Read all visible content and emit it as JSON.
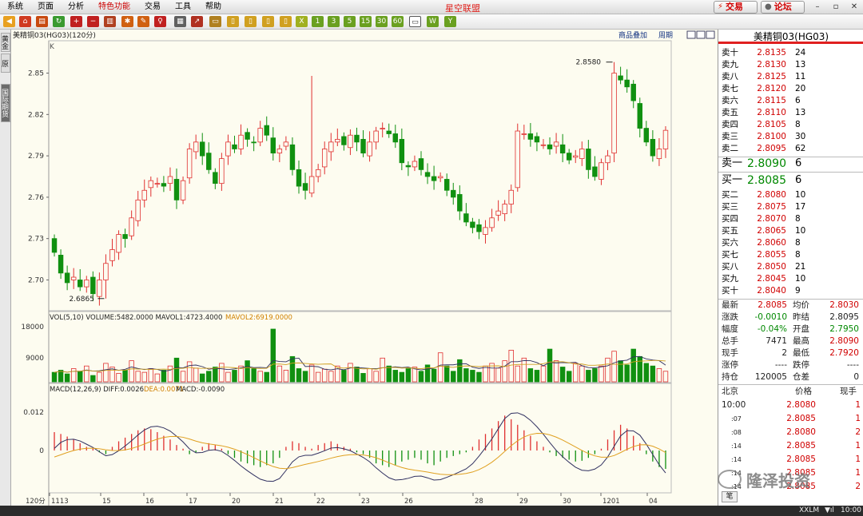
{
  "app": {
    "title": "星空联盟",
    "menu": [
      "系统",
      "页面",
      "分析",
      "特色功能",
      "交易",
      "工具",
      "帮助"
    ],
    "trade_button": "交易",
    "forum_button": "论坛"
  },
  "left_tabs": [
    "黄金",
    "原",
    "国际期货"
  ],
  "chart": {
    "header_left": "美精铜03(HG03)(120分)",
    "header_link1": "商品叠加",
    "header_link2": "周期",
    "k_label": "K",
    "high_label": "2.8580",
    "low_label": "2.6865",
    "period_label": "120分",
    "vol_header": "VOL(5,10) VOLUME:5482.0000 MAVOL1:4723.4000",
    "vol_header_b": "MAVOL2:6919.0000",
    "macd_header": "MACD(12,26,9) DIFF:0.0026",
    "macd_dea": "DEA:0.0071",
    "macd_val": "MACD:-0.0090",
    "colors": {
      "up": "#e03030",
      "down": "#109010",
      "bg": "#fdfcf0",
      "diff": "#303060",
      "dea": "#e0a020"
    }
  },
  "chart_data": {
    "type": "candlestick",
    "price_axis": [
      "2.85",
      "2.82",
      "2.79",
      "2.76",
      "2.73",
      "2.70"
    ],
    "price_range": [
      2.68,
      2.87
    ],
    "vol_axis": [
      "18000",
      "9000"
    ],
    "macd_axis": [
      "0.012",
      "0"
    ],
    "x_labels": [
      "1113",
      "15",
      "16",
      "17",
      "20",
      "21",
      "22",
      "23",
      "26",
      "28",
      "29",
      "30",
      "1201",
      "04"
    ],
    "closes": [
      2.72,
      2.705,
      2.698,
      2.702,
      2.695,
      2.7,
      2.69,
      2.7,
      2.712,
      2.722,
      2.733,
      2.73,
      2.745,
      2.758,
      2.765,
      2.772,
      2.77,
      2.768,
      2.775,
      2.758,
      2.772,
      2.795,
      2.8,
      2.79,
      2.78,
      2.77,
      2.788,
      2.8,
      2.795,
      2.805,
      2.802,
      2.8,
      2.81,
      2.805,
      2.792,
      2.795,
      2.8,
      2.78,
      2.768,
      2.765,
      2.775,
      2.78,
      2.795,
      2.8,
      2.802,
      2.798,
      2.805,
      2.8,
      2.792,
      2.8,
      2.808,
      2.81,
      2.806,
      2.8,
      2.785,
      2.782,
      2.786,
      2.78,
      2.775,
      2.772,
      2.775,
      2.765,
      2.76,
      2.75,
      2.742,
      2.738,
      2.735,
      2.738,
      2.745,
      2.75,
      2.755,
      2.765,
      2.808,
      2.806,
      2.802,
      2.8,
      2.798,
      2.795,
      2.8,
      2.792,
      2.787,
      2.79,
      2.795,
      2.78,
      2.775,
      2.785,
      2.79,
      2.85,
      2.845,
      2.84,
      2.83,
      2.81,
      2.8,
      2.79,
      2.795,
      2.8085
    ],
    "volume_heights": [
      0.18,
      0.22,
      0.15,
      0.25,
      0.2,
      0.3,
      0.12,
      0.18,
      0.35,
      0.28,
      0.16,
      0.22,
      0.4,
      0.2,
      0.18,
      0.25,
      0.15,
      0.22,
      0.3,
      0.45,
      0.2,
      0.38,
      0.26,
      0.15,
      0.2,
      0.28,
      0.35,
      0.18,
      0.22,
      0.3,
      0.4,
      0.25,
      0.2,
      0.18,
      1.0,
      0.3,
      0.22,
      0.48,
      0.25,
      0.2,
      0.32,
      0.18,
      0.24,
      0.2,
      0.3,
      0.22,
      0.35,
      0.28,
      0.16,
      0.25,
      0.2,
      0.45,
      0.3,
      0.22,
      0.18,
      0.25,
      0.28,
      0.2,
      0.32,
      0.24,
      0.55,
      0.3,
      0.2,
      0.42,
      0.25,
      0.22,
      0.18,
      0.3,
      0.35,
      0.26,
      0.4,
      0.6,
      0.3,
      0.45,
      0.25,
      0.22,
      0.3,
      0.62,
      0.4,
      0.28,
      0.2,
      0.35,
      0.3,
      0.22,
      0.25,
      0.3,
      0.45,
      0.58,
      0.4,
      0.32,
      0.62,
      0.48,
      0.35,
      0.3,
      0.25,
      0.2
    ],
    "macd_hist": [
      0.5,
      0.45,
      0.38,
      0.3,
      0.2,
      0.1,
      0.05,
      -0.05,
      -0.1,
      0.1,
      0.25,
      0.35,
      0.45,
      0.55,
      0.6,
      0.58,
      0.5,
      0.4,
      0.3,
      0.15,
      0.05,
      -0.1,
      -0.05,
      0.1,
      0.2,
      0.15,
      0.05,
      -0.1,
      -0.2,
      -0.3,
      -0.35,
      -0.4,
      -0.45,
      -0.4,
      -0.35,
      -0.2,
      0.1,
      0.25,
      0.2,
      0.1,
      0.05,
      0.15,
      0.2,
      0.25,
      0.18,
      0.1,
      0.05,
      -0.05,
      -0.1,
      -0.2,
      -0.35,
      -0.4,
      -0.45,
      -0.4,
      -0.3,
      -0.25,
      -0.2,
      -0.25,
      -0.35,
      -0.4,
      -0.3,
      -0.2,
      -0.15,
      -0.1,
      -0.05,
      0.1,
      0.3,
      0.45,
      0.6,
      0.8,
      0.95,
      0.85,
      0.7,
      0.55,
      0.4,
      0.25,
      0.1,
      -0.05,
      -0.15,
      -0.2,
      -0.25,
      -0.3,
      -0.28,
      -0.2,
      -0.1,
      0.05,
      0.3,
      0.55,
      0.7,
      0.6,
      0.4,
      0.2,
      -0.1,
      -0.3,
      -0.45,
      -0.5
    ]
  },
  "quote": {
    "title": "美精铜03(HG03)",
    "asks": [
      {
        "label": "卖十",
        "price": "2.8135",
        "qty": "24"
      },
      {
        "label": "卖九",
        "price": "2.8130",
        "qty": "13"
      },
      {
        "label": "卖八",
        "price": "2.8125",
        "qty": "11"
      },
      {
        "label": "卖七",
        "price": "2.8120",
        "qty": "20"
      },
      {
        "label": "卖六",
        "price": "2.8115",
        "qty": "6"
      },
      {
        "label": "卖五",
        "price": "2.8110",
        "qty": "13"
      },
      {
        "label": "卖四",
        "price": "2.8105",
        "qty": "8"
      },
      {
        "label": "卖三",
        "price": "2.8100",
        "qty": "30"
      },
      {
        "label": "卖二",
        "price": "2.8095",
        "qty": "62"
      }
    ],
    "ask1": {
      "label": "卖一",
      "price": "2.8090",
      "qty": "6"
    },
    "bid1": {
      "label": "买一",
      "price": "2.8085",
      "qty": "6"
    },
    "bids": [
      {
        "label": "买二",
        "price": "2.8080",
        "qty": "10"
      },
      {
        "label": "买三",
        "price": "2.8075",
        "qty": "17"
      },
      {
        "label": "买四",
        "price": "2.8070",
        "qty": "8"
      },
      {
        "label": "买五",
        "price": "2.8065",
        "qty": "10"
      },
      {
        "label": "买六",
        "price": "2.8060",
        "qty": "8"
      },
      {
        "label": "买七",
        "price": "2.8055",
        "qty": "8"
      },
      {
        "label": "买八",
        "price": "2.8050",
        "qty": "21"
      },
      {
        "label": "买九",
        "price": "2.8045",
        "qty": "10"
      },
      {
        "label": "买十",
        "price": "2.8040",
        "qty": "9"
      }
    ],
    "stats": [
      {
        "l1": "最新",
        "v1": "2.8085",
        "l2": "均价",
        "v2": "2.8030"
      },
      {
        "l1": "涨跌",
        "v1": "-0.0010",
        "l2": "昨结",
        "v2": "2.8095"
      },
      {
        "l1": "幅度",
        "v1": "-0.04%",
        "l2": "开盘",
        "v2": "2.7950"
      },
      {
        "l1": "总手",
        "v1": "7471",
        "l2": "最高",
        "v2": "2.8090"
      },
      {
        "l1": "现手",
        "v1": "2",
        "l2": "最低",
        "v2": "2.7920"
      },
      {
        "l1": "涨停",
        "v1": "----",
        "l2": "跌停",
        "v2": "----"
      },
      {
        "l1": "持仓",
        "v1": "120005",
        "l2": "仓差",
        "v2": "0"
      }
    ],
    "ticks_header": {
      "c1": "北京",
      "c2": "价格",
      "c3": "现手"
    },
    "ticks": [
      {
        "t": "10:00",
        "p": "2.8080",
        "q": "1"
      },
      {
        "t": ":07",
        "p": "2.8085",
        "q": "1"
      },
      {
        "t": ":08",
        "p": "2.8080",
        "q": "2"
      },
      {
        "t": ":14",
        "p": "2.8085",
        "q": "1"
      },
      {
        "t": ":14",
        "p": "2.8085",
        "q": "1"
      },
      {
        "t": ":14",
        "p": "2.8085",
        "q": "1"
      },
      {
        "t": ":14",
        "p": "2.8085",
        "q": "2"
      }
    ],
    "bottom_tab": "笔"
  },
  "watermark": "隆泽投资",
  "status": {
    "right": "10:00",
    "brand": "XXLM"
  }
}
